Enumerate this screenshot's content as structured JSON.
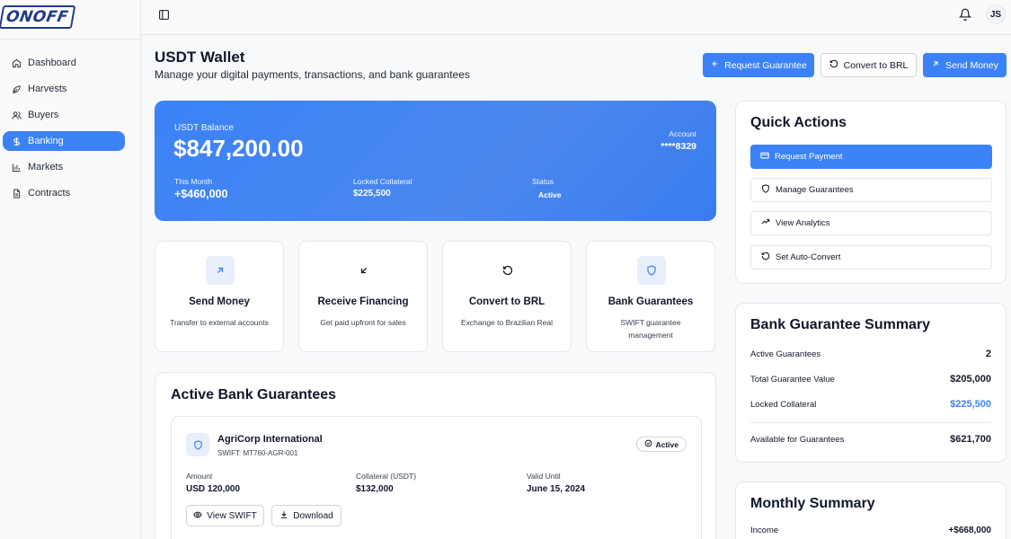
{
  "app": {
    "logo_text": "ONOFF"
  },
  "sidebar": {
    "items": [
      {
        "label": "Dashboard",
        "icon": "home-icon"
      },
      {
        "label": "Harvests",
        "icon": "leaf-icon"
      },
      {
        "label": "Buyers",
        "icon": "users-icon"
      },
      {
        "label": "Banking",
        "icon": "dollar-icon",
        "active": true
      },
      {
        "label": "Markets",
        "icon": "chart-icon"
      },
      {
        "label": "Contracts",
        "icon": "document-icon"
      }
    ]
  },
  "topbar": {
    "avatar_initials": "JS"
  },
  "header": {
    "title": "USDT Wallet",
    "subtitle": "Manage your digital payments, transactions, and bank guarantees",
    "request_guarantee": "Request Guarantee",
    "convert_brl": "Convert to BRL",
    "send_money": "Send Money"
  },
  "balance": {
    "label": "USDT Balance",
    "amount": "$847,200.00",
    "account_label": "Account",
    "account_value": "****8329",
    "month_label": "This Month",
    "month_value": "+$460,000",
    "collateral_label": "Locked Collateral",
    "collateral_value": "$225,500",
    "status_label": "Status",
    "status_value": "Active"
  },
  "actions": [
    {
      "title": "Send Money",
      "desc": "Transfer to external accounts",
      "icon": "arrow-up-right-icon"
    },
    {
      "title": "Receive Financing",
      "desc": "Get paid upfront for sales",
      "icon": "arrow-down-left-icon"
    },
    {
      "title": "Convert to BRL",
      "desc": "Exchange to Brazilian Real",
      "icon": "rotate-icon"
    },
    {
      "title": "Bank Guarantees",
      "desc": "SWIFT guarantee management",
      "icon": "shield-icon"
    }
  ],
  "guarantees": {
    "title": "Active Bank Guarantees",
    "items": [
      {
        "name": "AgriCorp International",
        "swift": "SWIFT: MT760-AGR-001",
        "status": "Active",
        "amount_label": "Amount",
        "amount": "USD 120,000",
        "collateral_label": "Collateral (USDT)",
        "collateral": "$132,000",
        "valid_label": "Valid Until",
        "valid": "June 15, 2024",
        "view_swift": "View SWIFT",
        "download": "Download"
      }
    ]
  },
  "quick_actions": {
    "title": "Quick Actions",
    "items": [
      "Request Payment",
      "Manage Guarantees",
      "View Analytics",
      "Set Auto-Convert"
    ]
  },
  "guarantee_summary": {
    "title": "Bank Guarantee Summary",
    "rows": [
      {
        "label": "Active Guarantees",
        "value": "2"
      },
      {
        "label": "Total Guarantee Value",
        "value": "$205,000"
      },
      {
        "label": "Locked Collateral",
        "value": "$225,500"
      },
      {
        "label": "Available for Guarantees",
        "value": "$621,700"
      }
    ]
  },
  "monthly_summary": {
    "title": "Monthly Summary",
    "rows": [
      {
        "label": "Income",
        "value": "+$668,000"
      }
    ]
  },
  "colors": {
    "primary": "#3b82f6",
    "collateral_highlight": "#3b82f6"
  }
}
